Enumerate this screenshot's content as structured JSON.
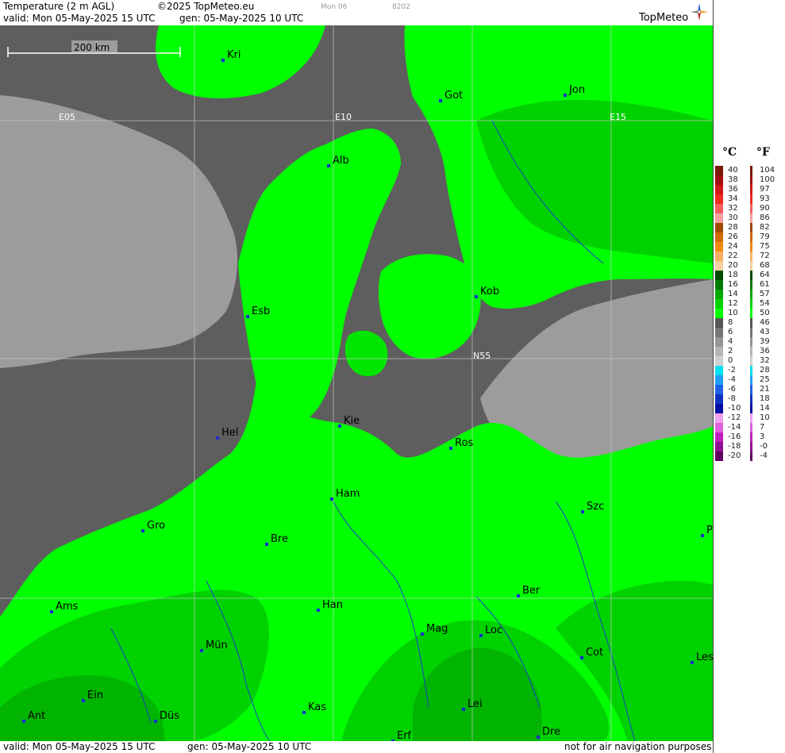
{
  "header": {
    "product": "Temperature (2 m AGL)",
    "copyright": "©2025 TopMeteo.eu",
    "day_code": "Mon 06",
    "run_code": "8202",
    "valid": "valid:  Mon  05-May-2025  15 UTC",
    "generated": "gen: 05-May-2025 10 UTC",
    "brand": "TopMeteo"
  },
  "footer": {
    "valid": "valid:  Mon  05-May-2025  15 UTC",
    "generated": "gen: 05-May-2025 10 UTC",
    "disclaimer": "not for air navigation purposes"
  },
  "map": {
    "scale_label": "200 km",
    "grid_labels": [
      "E05",
      "E10",
      "E15",
      "N55"
    ],
    "cities": [
      {
        "code": "Kri"
      },
      {
        "code": "Got"
      },
      {
        "code": "Jon"
      },
      {
        "code": "Alb"
      },
      {
        "code": "Kob"
      },
      {
        "code": "Esb"
      },
      {
        "code": "Kie"
      },
      {
        "code": "Hel"
      },
      {
        "code": "Ros"
      },
      {
        "code": "Ham"
      },
      {
        "code": "Szc"
      },
      {
        "code": "Gro"
      },
      {
        "code": "Bre"
      },
      {
        "code": "P"
      },
      {
        "code": "Ber"
      },
      {
        "code": "Ams"
      },
      {
        "code": "Han"
      },
      {
        "code": "Mag"
      },
      {
        "code": "Loc"
      },
      {
        "code": "Mün"
      },
      {
        "code": "Cot"
      },
      {
        "code": "Les"
      },
      {
        "code": "Ein"
      },
      {
        "code": "Lei"
      },
      {
        "code": "Kas"
      },
      {
        "code": "Ant"
      },
      {
        "code": "Düs"
      },
      {
        "code": "Dre"
      },
      {
        "code": "Erf"
      }
    ],
    "colors": {
      "sea_dark": "#5e5e5e",
      "sea_light": "#9c9c9c",
      "green_bright": "#00ff00",
      "green_mid": "#00e600",
      "green_dark": "#00c800",
      "green_deep": "#00a000"
    }
  },
  "legend": {
    "celsius_unit": "°C",
    "fahrenheit_unit": "°F",
    "levels": [
      {
        "c": "40",
        "f": "104",
        "color": "#7a1a00"
      },
      {
        "c": "38",
        "f": "100",
        "color": "#a01010"
      },
      {
        "c": "36",
        "f": "97",
        "color": "#d01818"
      },
      {
        "c": "34",
        "f": "93",
        "color": "#f02a20"
      },
      {
        "c": "32",
        "f": "90",
        "color": "#f86060"
      },
      {
        "c": "30",
        "f": "86",
        "color": "#f8a0a0"
      },
      {
        "c": "28",
        "f": "82",
        "color": "#a04a00"
      },
      {
        "c": "26",
        "f": "79",
        "color": "#d06a00"
      },
      {
        "c": "24",
        "f": "75",
        "color": "#f08a10"
      },
      {
        "c": "22",
        "f": "72",
        "color": "#f8b060"
      },
      {
        "c": "20",
        "f": "68",
        "color": "#f8d0a0"
      },
      {
        "c": "18",
        "f": "64",
        "color": "#004a00"
      },
      {
        "c": "16",
        "f": "61",
        "color": "#007a00"
      },
      {
        "c": "14",
        "f": "57",
        "color": "#00a800"
      },
      {
        "c": "12",
        "f": "54",
        "color": "#00d200"
      },
      {
        "c": "10",
        "f": "50",
        "color": "#00ff00"
      },
      {
        "c": "8",
        "f": "46",
        "color": "#555555"
      },
      {
        "c": "6",
        "f": "43",
        "color": "#757575"
      },
      {
        "c": "4",
        "f": "39",
        "color": "#959595"
      },
      {
        "c": "2",
        "f": "36",
        "color": "#b5b5b5"
      },
      {
        "c": "0",
        "f": "32",
        "color": "#d0d0d0"
      },
      {
        "c": "-2",
        "f": "28",
        "color": "#00e0f0"
      },
      {
        "c": "-4",
        "f": "25",
        "color": "#20a0f8"
      },
      {
        "c": "-6",
        "f": "21",
        "color": "#2060e8"
      },
      {
        "c": "-8",
        "f": "18",
        "color": "#1030c0"
      },
      {
        "c": "-10",
        "f": "14",
        "color": "#0010a0"
      },
      {
        "c": "-12",
        "f": "10",
        "color": "#f0a0f0"
      },
      {
        "c": "-14",
        "f": "7",
        "color": "#e060e0"
      },
      {
        "c": "-16",
        "f": "3",
        "color": "#c020c0"
      },
      {
        "c": "-18",
        "f": "-0",
        "color": "#901090"
      },
      {
        "c": "-20",
        "f": "-4",
        "color": "#600060"
      }
    ]
  }
}
